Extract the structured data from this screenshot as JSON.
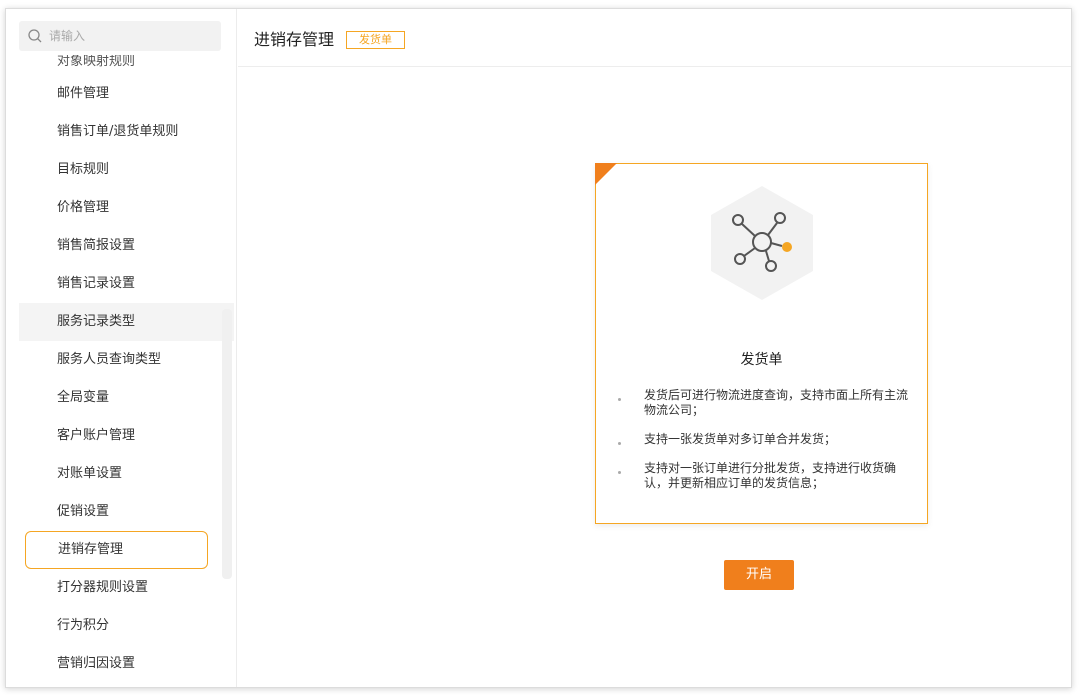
{
  "search": {
    "placeholder": "请输入"
  },
  "sidebar": {
    "items": [
      {
        "label": "对象映射规则"
      },
      {
        "label": "邮件管理"
      },
      {
        "label": "销售订单/退货单规则"
      },
      {
        "label": "目标规则"
      },
      {
        "label": "价格管理"
      },
      {
        "label": "销售简报设置"
      },
      {
        "label": "销售记录设置"
      },
      {
        "label": "服务记录类型"
      },
      {
        "label": "服务人员查询类型"
      },
      {
        "label": "全局变量"
      },
      {
        "label": "客户账户管理"
      },
      {
        "label": "对账单设置"
      },
      {
        "label": "促销设置"
      },
      {
        "label": "进销存管理"
      },
      {
        "label": "打分器规则设置"
      },
      {
        "label": "行为积分"
      },
      {
        "label": "营销归因设置"
      }
    ]
  },
  "header": {
    "title": "进销存管理",
    "badge": "发货单"
  },
  "card": {
    "title": "发货单",
    "features": [
      "发货后可进行物流进度查询，支持市面上所有主流物流公司；",
      "支持一张发货单对多订单合并发货；",
      "支持对一张订单进行分批发货，支持进行收货确认，并更新相应订单的发货信息；"
    ]
  },
  "actions": {
    "open_label": "开启"
  },
  "colors": {
    "accent": "#f5a623",
    "button": "#f07f1c"
  }
}
